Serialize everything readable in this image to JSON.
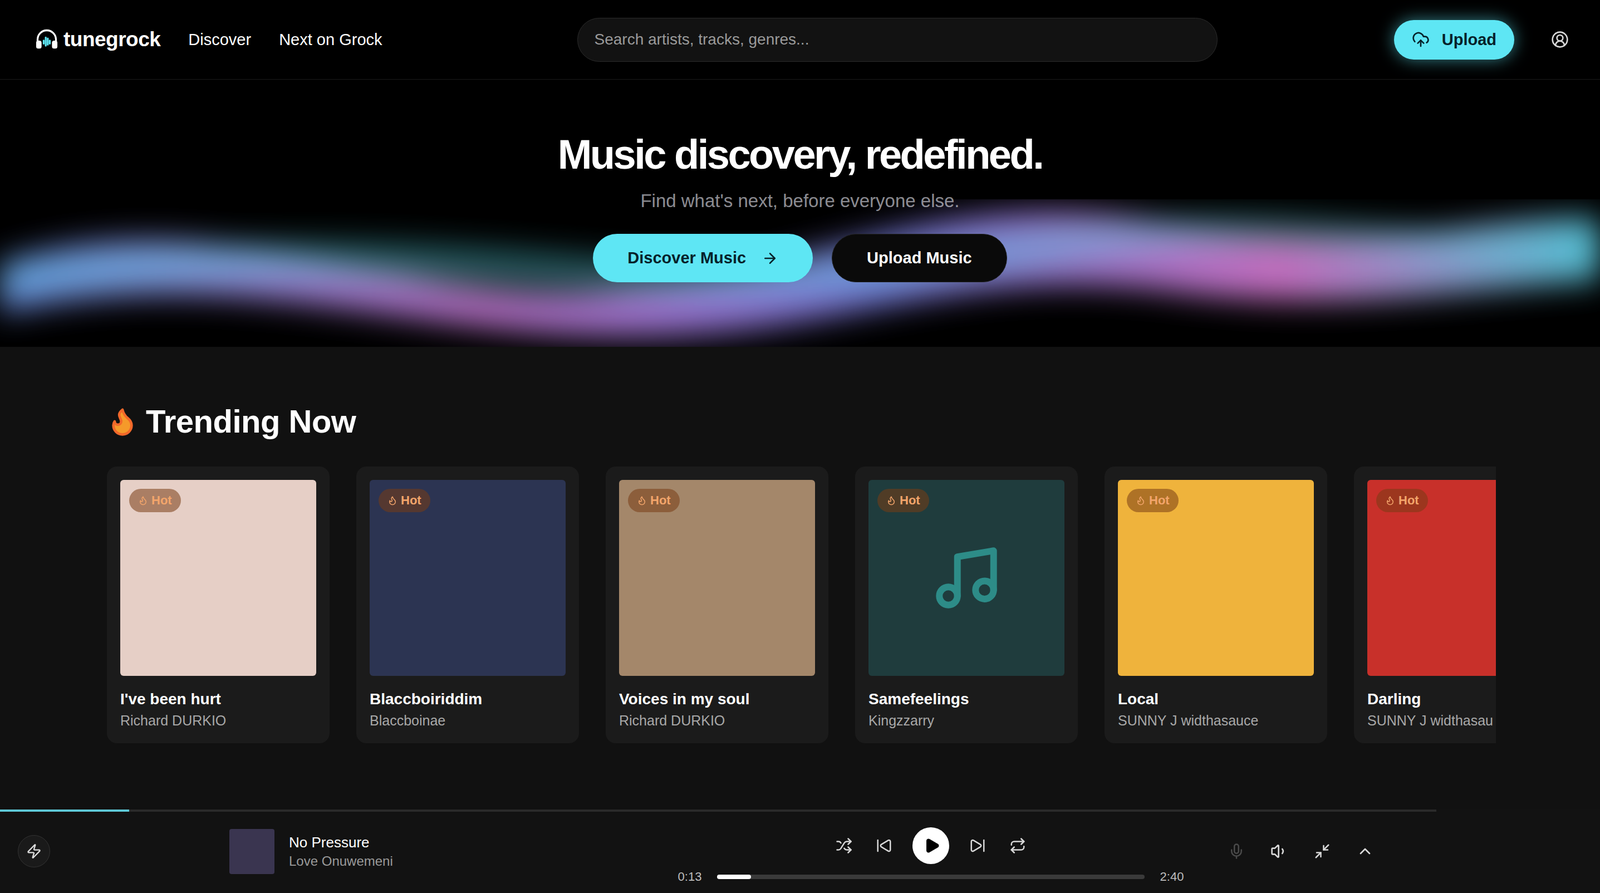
{
  "header": {
    "logo": "tunegrock",
    "nav": [
      "Discover",
      "Next on Grock"
    ],
    "search": {
      "placeholder": "Search artists, tracks, genres..."
    },
    "upload": "Upload"
  },
  "hero": {
    "title": "Music discovery, redefined.",
    "subtitle": "Find what's next, before everyone else.",
    "actions": [
      {
        "label": "Discover Music",
        "kind": "primary"
      },
      {
        "label": "Upload Music",
        "kind": "secondary"
      }
    ]
  },
  "trending": {
    "title": "Trending Now",
    "tracks": [
      {
        "title": "I've been hurt",
        "artist": "Richard DURKIO",
        "badge": "Hot",
        "kind": "image",
        "color": "#e6cfc6"
      },
      {
        "title": "Blaccboiriddim",
        "artist": "Blaccboinae",
        "badge": "Hot",
        "kind": "image",
        "color": "#2c3452"
      },
      {
        "title": "Voices in my soul",
        "artist": "Richard DURKIO",
        "badge": "Hot",
        "kind": "image",
        "color": "#a4876a"
      },
      {
        "title": "Samefeelings",
        "artist": "Kingzzarry",
        "badge": "Hot",
        "kind": "placeholder",
        "color": "#1f3c3d"
      },
      {
        "title": "Local",
        "artist": "SUNNY J widthasauce",
        "badge": "Hot",
        "kind": "image",
        "color": "#efb33c"
      },
      {
        "title": "Darling",
        "artist": "SUNNY J widthasau",
        "badge": "Hot",
        "kind": "image",
        "color": "#c8302a"
      }
    ]
  },
  "player": {
    "page_progress": {
      "level": 0.09
    },
    "track": {
      "title": "No Pressure",
      "artist": "Love Onuwemeni",
      "color": "#3a3550"
    },
    "playing": false,
    "elapsed": "0:13",
    "duration": "2:40",
    "level": 0.08,
    "mic_disabled": true
  }
}
